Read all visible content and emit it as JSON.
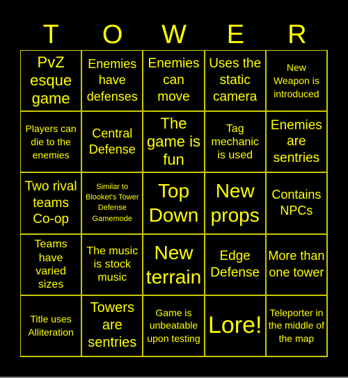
{
  "title_letters": [
    "T",
    "O",
    "W",
    "E",
    "R"
  ],
  "colors": {
    "background": "#000000",
    "text": "#ffff00",
    "grid_line": "#c8c800"
  },
  "cells": [
    [
      "PvZ esque game",
      "Enemies have defenses",
      "Enemies can move",
      "Uses the static camera",
      "New Weapon is introduced"
    ],
    [
      "Players can die to the enemies",
      "Central Defense",
      "The game is fun",
      "Tag mechanic is used",
      "Enemies are sentries"
    ],
    [
      "Two rival teams Co-op",
      "Similar to Blooket's Tower Defense Gamemode",
      "Top Down",
      "New props",
      "Contains NPCs"
    ],
    [
      "Teams have varied sizes",
      "The music is stock music",
      "New terrain",
      "Edge Defense",
      "More than one tower"
    ],
    [
      "Title uses Alliteration",
      "Towers are sentries",
      "Game is unbeatable upon testing",
      "Lore!",
      "Teleporter in the middle of the map"
    ]
  ]
}
